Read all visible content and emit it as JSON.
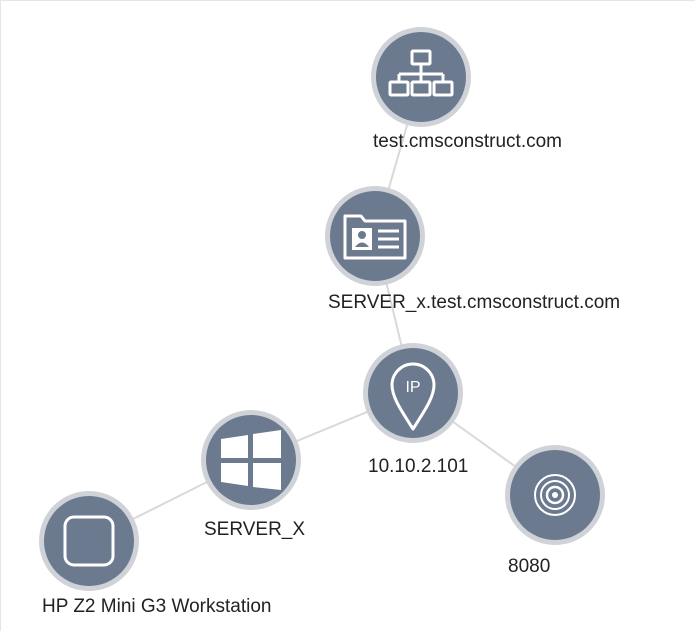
{
  "graph": {
    "nodes": [
      {
        "id": "domain",
        "label": "test.cmsconstruct.com",
        "icon": "network-hierarchy-icon"
      },
      {
        "id": "host",
        "label": "SERVER_x.test.cmsconstruct.com",
        "icon": "id-card-icon"
      },
      {
        "id": "ip",
        "label": "10.10.2.101",
        "icon": "ip-location-pin-icon"
      },
      {
        "id": "os",
        "label": "SERVER_X",
        "icon": "windows-logo-icon"
      },
      {
        "id": "port",
        "label": "8080",
        "icon": "port-target-icon"
      },
      {
        "id": "device",
        "label": "HP Z2 Mini G3 Workstation",
        "icon": "device-square-icon"
      }
    ],
    "edges": [
      [
        "domain",
        "host"
      ],
      [
        "host",
        "ip"
      ],
      [
        "ip",
        "os"
      ],
      [
        "ip",
        "port"
      ],
      [
        "os",
        "device"
      ]
    ],
    "colors": {
      "node_fill": "#6b7a8f",
      "node_ring": "#cfd3d8",
      "edge": "#d9d9d9",
      "icon": "#ffffff",
      "text": "#222222"
    }
  }
}
